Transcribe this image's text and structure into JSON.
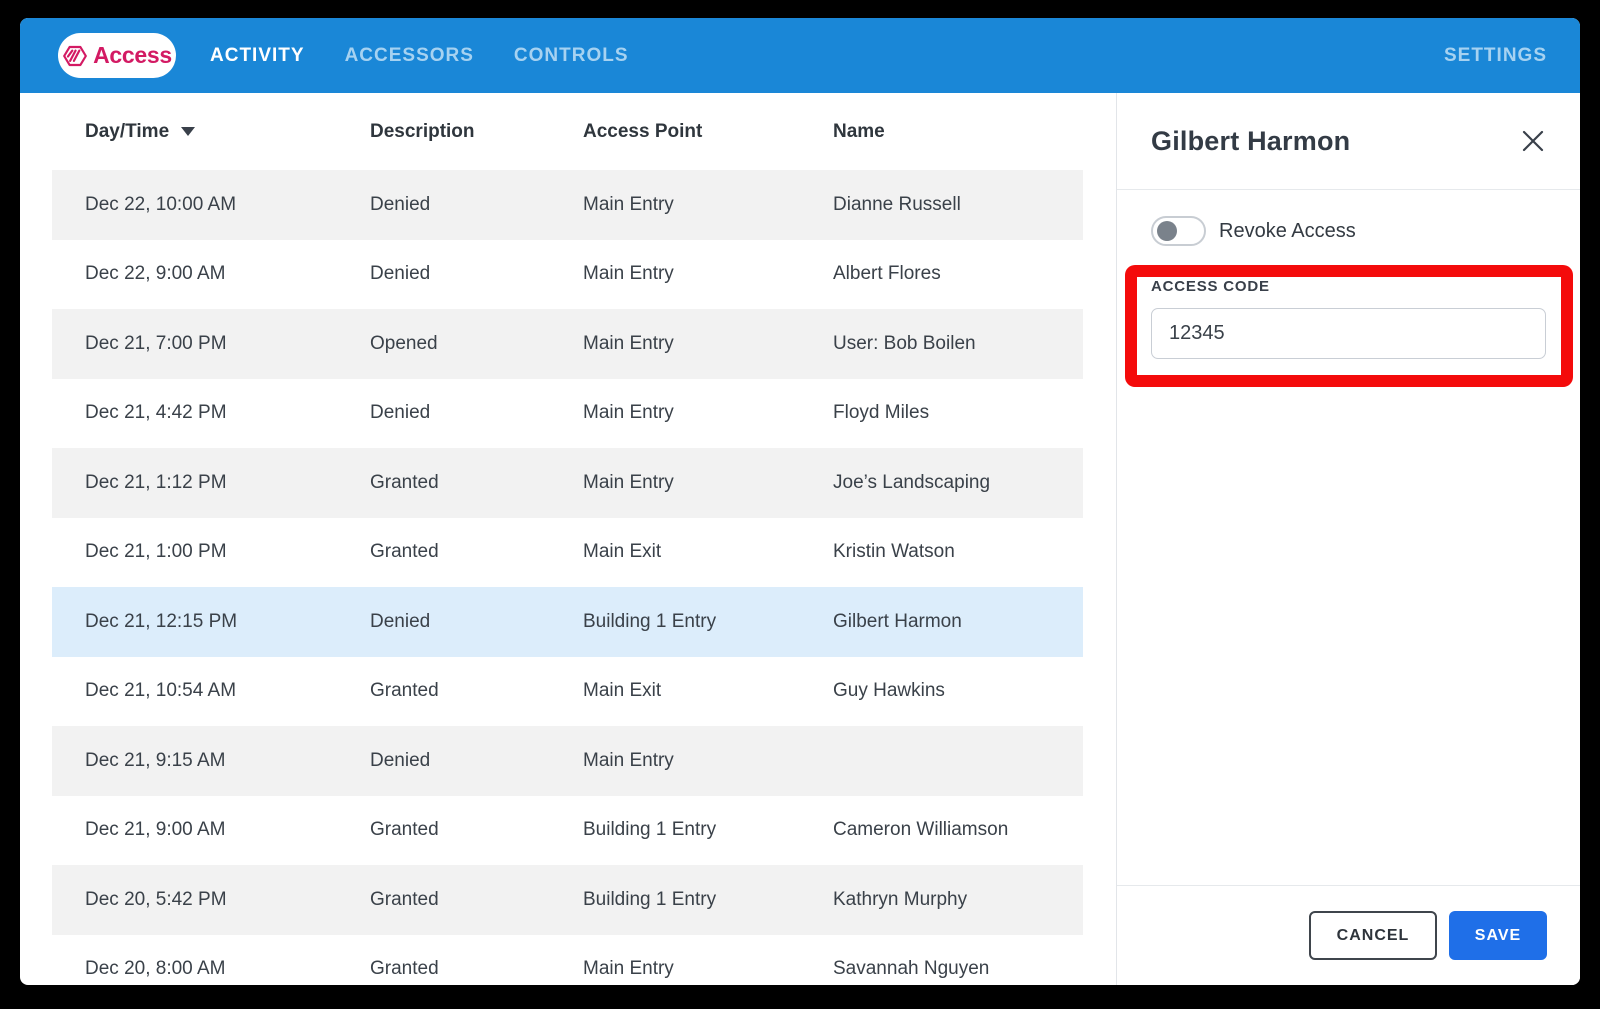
{
  "nav": {
    "brand": "Access",
    "tabs": [
      {
        "label": "ACTIVITY",
        "active": true
      },
      {
        "label": "ACCESSORS",
        "active": false
      },
      {
        "label": "CONTROLS",
        "active": false
      }
    ],
    "settings_label": "SETTINGS"
  },
  "table": {
    "columns": [
      "Day/Time",
      "Description",
      "Access Point",
      "Name"
    ],
    "sort_column": "Day/Time",
    "sort_direction": "desc",
    "rows": [
      {
        "time": "Dec 22, 10:00 AM",
        "description": "Denied",
        "access_point": "Main Entry",
        "name": "Dianne Russell",
        "selected": false
      },
      {
        "time": "Dec 22, 9:00 AM",
        "description": "Denied",
        "access_point": "Main Entry",
        "name": "Albert Flores",
        "selected": false
      },
      {
        "time": "Dec 21, 7:00 PM",
        "description": "Opened",
        "access_point": "Main Entry",
        "name": "User: Bob Boilen",
        "selected": false
      },
      {
        "time": "Dec 21, 4:42 PM",
        "description": "Denied",
        "access_point": "Main Entry",
        "name": "Floyd Miles",
        "selected": false
      },
      {
        "time": "Dec 21, 1:12 PM",
        "description": "Granted",
        "access_point": "Main Entry",
        "name": "Joe’s Landscaping",
        "selected": false
      },
      {
        "time": "Dec 21, 1:00 PM",
        "description": "Granted",
        "access_point": "Main Exit",
        "name": "Kristin Watson",
        "selected": false
      },
      {
        "time": "Dec 21, 12:15 PM",
        "description": "Denied",
        "access_point": "Building 1 Entry",
        "name": "Gilbert Harmon",
        "selected": true
      },
      {
        "time": "Dec 21, 10:54 AM",
        "description": "Granted",
        "access_point": "Main Exit",
        "name": "Guy Hawkins",
        "selected": false
      },
      {
        "time": "Dec 21, 9:15 AM",
        "description": "Denied",
        "access_point": "Main Entry",
        "name": "",
        "selected": false
      },
      {
        "time": "Dec 21, 9:00 AM",
        "description": "Granted",
        "access_point": "Building 1 Entry",
        "name": "Cameron Williamson",
        "selected": false
      },
      {
        "time": "Dec 20, 5:42 PM",
        "description": "Granted",
        "access_point": "Building 1 Entry",
        "name": "Kathryn Murphy",
        "selected": false
      },
      {
        "time": "Dec 20, 8:00 AM",
        "description": "Granted",
        "access_point": "Main Entry",
        "name": "Savannah Nguyen",
        "selected": false
      }
    ]
  },
  "panel": {
    "title": "Gilbert Harmon",
    "revoke_toggle": {
      "label": "Revoke Access",
      "on": false
    },
    "access_code": {
      "label": "ACCESS CODE",
      "value": "12345"
    },
    "footer": {
      "cancel_label": "CANCEL",
      "save_label": "SAVE"
    }
  },
  "annotation": {
    "type": "highlight-box",
    "color": "#F40B0B",
    "around": "ACCESS CODE field"
  },
  "colors": {
    "navbar_blue": "#1A87D7",
    "inactive_tab": "#A6D2F1",
    "brand_pink": "#D31A63",
    "row_stripe": "#F2F2F2",
    "selected_row": "#DCEDFB",
    "text": "#3A4149",
    "save_blue": "#1F6FE8",
    "annotation_red": "#F40B0B"
  }
}
